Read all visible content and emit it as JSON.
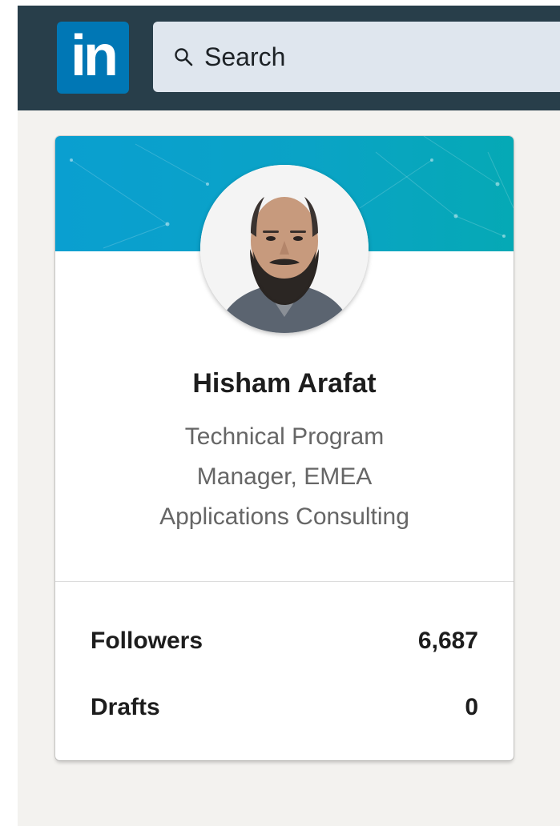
{
  "navbar": {
    "logo_text": "in",
    "search": {
      "placeholder": "Search",
      "icon": "search-icon"
    }
  },
  "profile_card": {
    "name": "Hisham Arafat",
    "headline_lines": [
      "Technical Program",
      "Manager, EMEA",
      "Applications Consulting"
    ],
    "stats": [
      {
        "label": "Followers",
        "value": "6,687"
      },
      {
        "label": "Drafts",
        "value": "0"
      }
    ]
  },
  "colors": {
    "navbar_bg": "#283e4a",
    "brand_blue": "#0077b5",
    "cover_teal": "#0aa3c6",
    "page_bg": "#f3f2ef"
  }
}
